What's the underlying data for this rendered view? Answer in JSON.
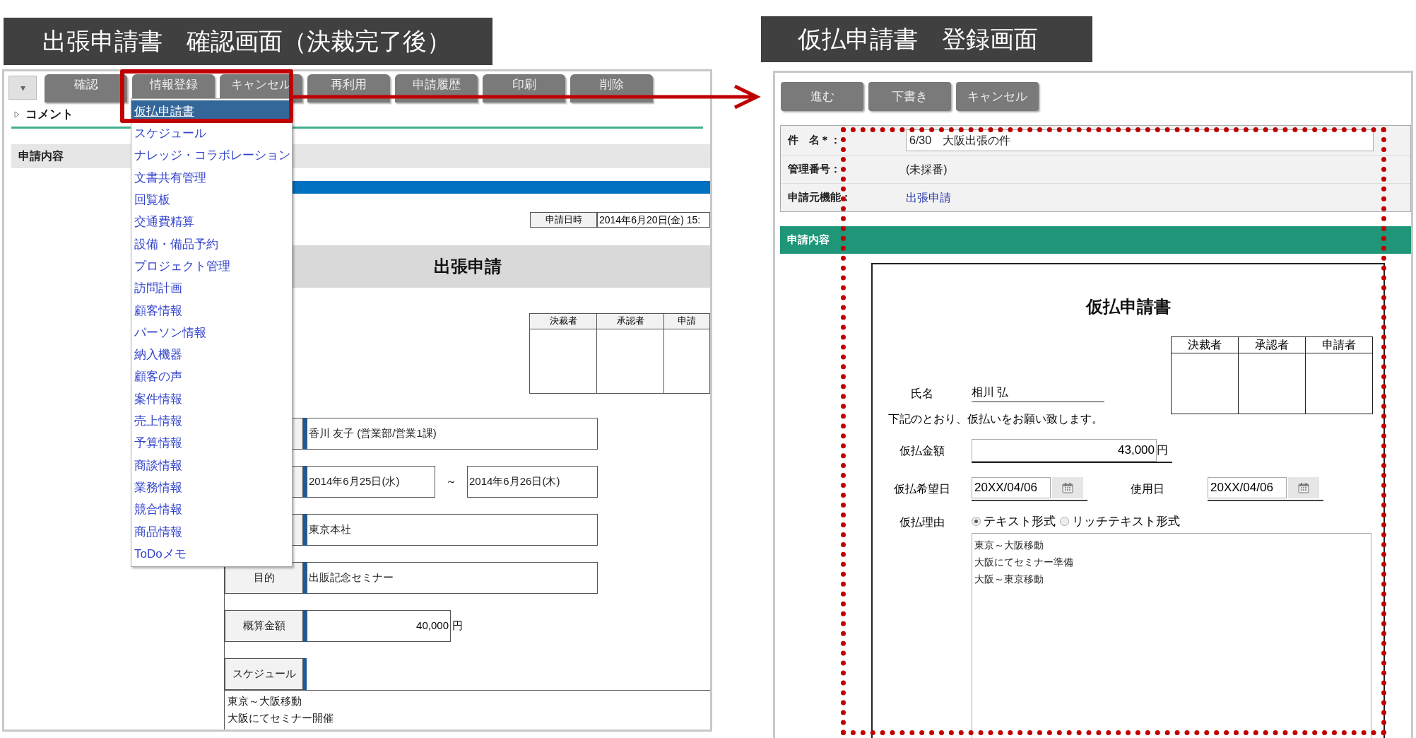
{
  "left": {
    "title": "出張申請書　確認画面（決裁完了後）",
    "toolbar": {
      "menu_toggle": "▾",
      "buttons": [
        "確認",
        "情報登録",
        "キャンセル",
        "再利用",
        "申請履歴",
        "印刷",
        "削除"
      ]
    },
    "comment_section": "コメント",
    "section_header": "申請内容",
    "dropdown": {
      "items": [
        {
          "label": "仮払申請書",
          "selected": true
        },
        {
          "label": "スケジュール",
          "selected": false
        },
        {
          "label": "ナレッジ・コラボレーション",
          "selected": false
        },
        {
          "label": "文書共有管理",
          "selected": false
        },
        {
          "label": "回覧板",
          "selected": false
        },
        {
          "label": "交通費精算",
          "selected": false
        },
        {
          "label": "設備・備品予約",
          "selected": false
        },
        {
          "label": "プロジェクト管理",
          "selected": false
        },
        {
          "label": "訪問計画",
          "selected": false
        },
        {
          "label": "顧客情報",
          "selected": false
        },
        {
          "label": "パーソン情報",
          "selected": false
        },
        {
          "label": "納入機器",
          "selected": false
        },
        {
          "label": "顧客の声",
          "selected": false
        },
        {
          "label": "案件情報",
          "selected": false
        },
        {
          "label": "売上情報",
          "selected": false
        },
        {
          "label": "予算情報",
          "selected": false
        },
        {
          "label": "商談情報",
          "selected": false
        },
        {
          "label": "業務情報",
          "selected": false
        },
        {
          "label": "競合情報",
          "selected": false
        },
        {
          "label": "商品情報",
          "selected": false
        },
        {
          "label": "ToDoメモ",
          "selected": false
        }
      ]
    },
    "document": {
      "datetime": {
        "label": "申請日時",
        "value": "2014年6月20日(金) 15:"
      },
      "title": "出張申請",
      "approval_columns": [
        "決裁者",
        "承認者",
        "申請"
      ],
      "rows": [
        {
          "kind": "single",
          "value": "香川 友子 (営業部/営業1課)"
        },
        {
          "kind": "range",
          "from": "2014年6月25日(水)",
          "separator": "～",
          "to": "2014年6月26日(木)"
        },
        {
          "kind": "single",
          "value": "東京本社"
        },
        {
          "kind": "single",
          "label": "目的",
          "value": "出販記念セミナー"
        },
        {
          "kind": "amount",
          "label": "概算金額",
          "value": "40,000",
          "unit": "円"
        },
        {
          "kind": "multiline",
          "label": "スケジュール",
          "lines": [
            "東京～大阪移動",
            "大阪にてセミナー開催"
          ]
        }
      ]
    }
  },
  "right": {
    "title": "仮払申請書　登録画面",
    "buttons": [
      "進む",
      "下書き",
      "キャンセル"
    ],
    "fields": [
      {
        "kind": "input",
        "label": "件　名＊：",
        "value": "6/30　大阪出張の件"
      },
      {
        "kind": "text",
        "label": "管理番号：",
        "value": "(未採番)"
      },
      {
        "kind": "link",
        "label": "申請元機能：",
        "value": "出張申請"
      }
    ],
    "section_header": "申請内容",
    "document": {
      "title": "仮払申請書",
      "approval_columns": [
        "決裁者",
        "承認者",
        "申請者"
      ],
      "name": {
        "label": "氏名",
        "value": "相川 弘"
      },
      "note": "下記のとおり、仮払いをお願い致します。",
      "amount": {
        "label": "仮払金額",
        "value": "43,000",
        "unit": "円"
      },
      "dates": [
        {
          "label": "仮払希望日",
          "value": "20XX/04/06"
        },
        {
          "label": "使用日",
          "value": "20XX/04/06"
        }
      ],
      "reason": {
        "label": "仮払理由",
        "options": [
          {
            "label": "テキスト形式",
            "selected": true
          },
          {
            "label": "リッチテキスト形式",
            "selected": false
          }
        ],
        "lines": [
          "東京～大阪移動",
          "大阪にてセミナー準備",
          "大阪～東京移動"
        ]
      }
    }
  }
}
